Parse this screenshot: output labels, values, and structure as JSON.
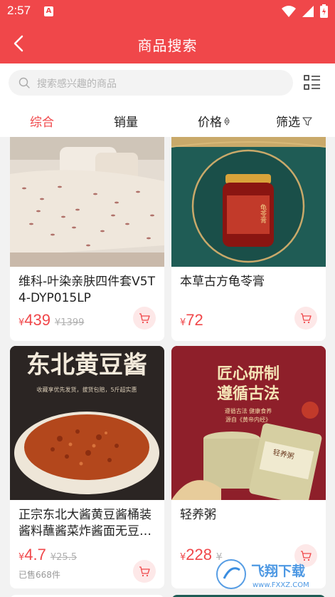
{
  "status": {
    "time": "2:57",
    "notif": "A"
  },
  "nav": {
    "title": "商品搜索"
  },
  "search": {
    "placeholder": "搜索感兴趣的商品"
  },
  "tabs": [
    {
      "label": "综合",
      "active": true
    },
    {
      "label": "销量",
      "active": false
    },
    {
      "label": "价格",
      "active": false,
      "icon": "sort-icon"
    },
    {
      "label": "筛选",
      "active": false,
      "icon": "filter-icon"
    }
  ],
  "products": [
    {
      "title": "维科-叶染亲肤四件套V5T4-DYP015LP",
      "yen": "¥",
      "price": "439",
      "orig_price": "¥1399",
      "sold": ""
    },
    {
      "title": "本草古方龟苓膏",
      "yen": "¥",
      "price": "72",
      "orig_price": "",
      "sold": ""
    },
    {
      "title": "正宗东北大酱黄豆酱桶装酱料蘸酱菜炸酱面无豆…",
      "yen": "¥",
      "price": "4.7",
      "orig_price": "¥25.5",
      "sold": "已售668件"
    },
    {
      "title": "轻养粥",
      "yen": "¥",
      "price": "228",
      "orig_price": "¥",
      "sold": ""
    }
  ],
  "images": {
    "jar_label": "龟苓膏",
    "sauce_title": "东北黄豆酱",
    "sauce_sub": "收藏享优先发货，拔货包赔，5斤超实惠",
    "tea_title1": "匠心研制",
    "tea_title2": "遵循古法",
    "tea_sub1": "遵循古法 健康食养",
    "tea_sub2": "源自《黄帝内经》",
    "tea_can": "轻养粥"
  },
  "watermark": {
    "text": "飞翔下载",
    "url": "www.FXXZ.COM"
  },
  "colors": {
    "brand": "#f0474a",
    "bg": "#f2f2f2"
  }
}
